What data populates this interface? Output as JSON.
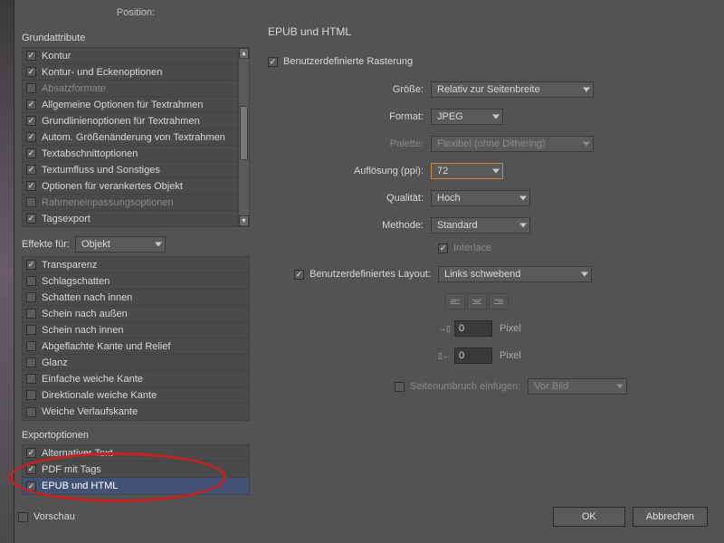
{
  "left": {
    "position_label": "Position:",
    "grund_title": "Grundattribute",
    "grund_items": [
      {
        "label": "Kontur",
        "checked": true
      },
      {
        "label": "Kontur- und Eckenoptionen",
        "checked": true
      },
      {
        "label": "Absatzformate",
        "checked": false,
        "disabled": true
      },
      {
        "label": "Allgemeine Optionen für Textrahmen",
        "checked": true
      },
      {
        "label": "Grundlinienoptionen für Textrahmen",
        "checked": true
      },
      {
        "label": "Autom. Größenänderung von Textrahmen",
        "checked": true
      },
      {
        "label": "Textabschnittoptionen",
        "checked": true
      },
      {
        "label": "Textumfluss und Sonstiges",
        "checked": true
      },
      {
        "label": "Optionen für verankertes Objekt",
        "checked": true
      },
      {
        "label": "Rahmeneinpassungsoptionen",
        "checked": false,
        "disabled": true
      },
      {
        "label": "Tagsexport",
        "checked": true
      }
    ],
    "effekte_label": "Effekte für:",
    "effekte_value": "Objekt",
    "effekte_items": [
      {
        "label": "Transparenz",
        "checked": true
      },
      {
        "label": "Schlagschatten",
        "checked": false
      },
      {
        "label": "Schatten nach innen",
        "checked": false
      },
      {
        "label": "Schein nach außen",
        "checked": false
      },
      {
        "label": "Schein nach innen",
        "checked": false
      },
      {
        "label": "Abgeflachte Kante und Relief",
        "checked": false
      },
      {
        "label": "Glanz",
        "checked": false
      },
      {
        "label": "Einfache weiche Kante",
        "checked": false
      },
      {
        "label": "Direktionale weiche Kante",
        "checked": false
      },
      {
        "label": "Weiche Verlaufskante",
        "checked": false
      }
    ],
    "export_title": "Exportoptionen",
    "export_items": [
      {
        "label": "Alternativer Text",
        "checked": true
      },
      {
        "label": "PDF mit Tags",
        "checked": true
      },
      {
        "label": "EPUB und HTML",
        "checked": true,
        "selected": true
      }
    ],
    "vorschau": "Vorschau"
  },
  "right": {
    "heading": "EPUB und HTML",
    "rasterung": "Benutzerdefinierte Rasterung",
    "size_label": "Größe:",
    "size_value": "Relativ zur Seitenbreite",
    "format_label": "Format:",
    "format_value": "JPEG",
    "palette_label": "Palette:",
    "palette_value": "Flexibel (ohne Dithering)",
    "resolution_label": "Auflösung (ppi):",
    "resolution_value": "72",
    "quality_label": "Qualität:",
    "quality_value": "Hoch",
    "method_label": "Methode:",
    "method_value": "Standard",
    "interlace": "Interlace",
    "layout_label": "Benutzerdefiniertes Layout:",
    "layout_value": "Links schwebend",
    "spacing1": "0",
    "spacing2": "0",
    "pixel": "Pixel",
    "pagebreak_label": "Seitenumbruch einfügen:",
    "pagebreak_value": "Vor Bild",
    "ok": "OK",
    "cancel": "Abbrechen"
  }
}
